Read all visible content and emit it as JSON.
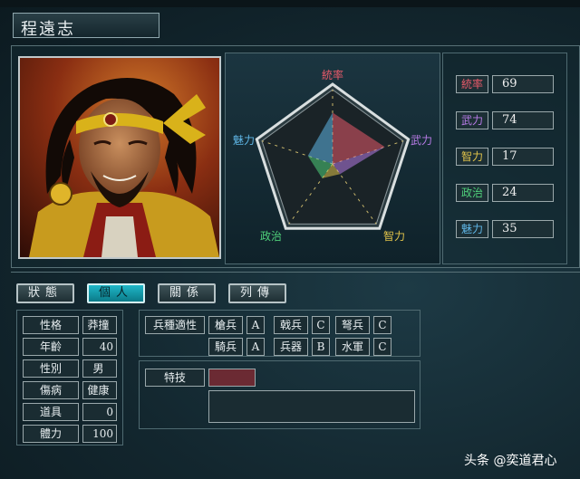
{
  "officer": {
    "name": "程遠志"
  },
  "radar": {
    "axis_labels": [
      "統率",
      "武力",
      "智力",
      "政治",
      "魅力"
    ],
    "values": [
      69,
      74,
      17,
      24,
      35
    ],
    "max": 100
  },
  "stats": [
    {
      "label": "統率",
      "value": "69",
      "color": "#e85a6a"
    },
    {
      "label": "武力",
      "value": "74",
      "color": "#b77be6"
    },
    {
      "label": "智力",
      "value": "17",
      "color": "#e0c34a"
    },
    {
      "label": "政治",
      "value": "24",
      "color": "#4fcf7a"
    },
    {
      "label": "魅力",
      "value": "35",
      "color": "#5fb6e6"
    }
  ],
  "tabs": [
    "狀態",
    "個人",
    "關係",
    "列傳"
  ],
  "active_tab": "個人",
  "personal": [
    {
      "label": "性格",
      "value": "莽撞"
    },
    {
      "label": "年齡",
      "value": "40"
    },
    {
      "label": "性別",
      "value": "男"
    },
    {
      "label": "傷病",
      "value": "健康"
    },
    {
      "label": "道具",
      "value": "0"
    },
    {
      "label": "體力",
      "value": "100"
    }
  ],
  "aptitude": {
    "title": "兵種適性",
    "units": [
      {
        "name": "槍兵",
        "grade": "A"
      },
      {
        "name": "戟兵",
        "grade": "C"
      },
      {
        "name": "弩兵",
        "grade": "C"
      },
      {
        "name": "騎兵",
        "grade": "A"
      },
      {
        "name": "兵器",
        "grade": "B"
      },
      {
        "name": "水軍",
        "grade": "C"
      }
    ]
  },
  "skill": {
    "label": "特技",
    "value": ""
  },
  "watermark": "头条 @奕道君心"
}
